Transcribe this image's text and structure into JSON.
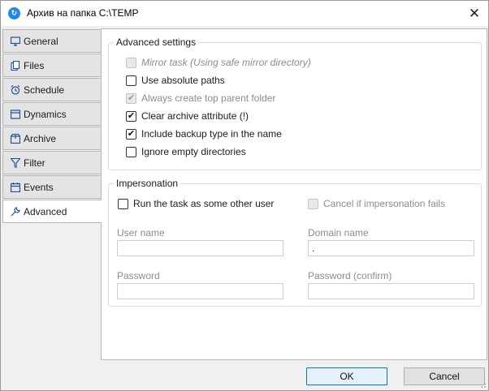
{
  "window": {
    "title": "Архив на папка C:\\TEMP",
    "app_icon": "clock-refresh-icon",
    "close_glyph": "✕"
  },
  "tabs": [
    {
      "label": "General",
      "icon": "monitor-icon"
    },
    {
      "label": "Files",
      "icon": "files-icon"
    },
    {
      "label": "Schedule",
      "icon": "alarm-clock-icon"
    },
    {
      "label": "Dynamics",
      "icon": "dynamics-window-icon"
    },
    {
      "label": "Archive",
      "icon": "archive-box-icon"
    },
    {
      "label": "Filter",
      "icon": "funnel-icon"
    },
    {
      "label": "Events",
      "icon": "calendar-icon"
    },
    {
      "label": "Advanced",
      "icon": "wrench-icon",
      "active": true
    }
  ],
  "advanced_settings": {
    "legend": "Advanced settings",
    "options": [
      {
        "label": "Mirror task (Using safe mirror directory)",
        "checked": false,
        "enabled": false
      },
      {
        "label": "Use absolute paths",
        "checked": false,
        "enabled": true
      },
      {
        "label": "Always create top parent folder",
        "checked": true,
        "enabled": false
      },
      {
        "label": "Clear archive attribute (!)",
        "checked": true,
        "enabled": true
      },
      {
        "label": "Include backup type in the name",
        "checked": true,
        "enabled": true
      },
      {
        "label": "Ignore empty directories",
        "checked": false,
        "enabled": true
      }
    ]
  },
  "impersonation": {
    "legend": "Impersonation",
    "run_as_other": {
      "label": "Run the task as some other user",
      "checked": false,
      "enabled": true
    },
    "cancel_if_fails": {
      "label": "Cancel if impersonation fails",
      "checked": false,
      "enabled": false
    },
    "user_name": {
      "label": "User name",
      "value": ""
    },
    "domain_name": {
      "label": "Domain name",
      "value": "."
    },
    "password": {
      "label": "Password",
      "value": ""
    },
    "password_confirm": {
      "label": "Password (confirm)",
      "value": ""
    }
  },
  "buttons": {
    "ok": "OK",
    "cancel": "Cancel"
  },
  "colors": {
    "accent": "#0078d4",
    "check": "#111111"
  }
}
